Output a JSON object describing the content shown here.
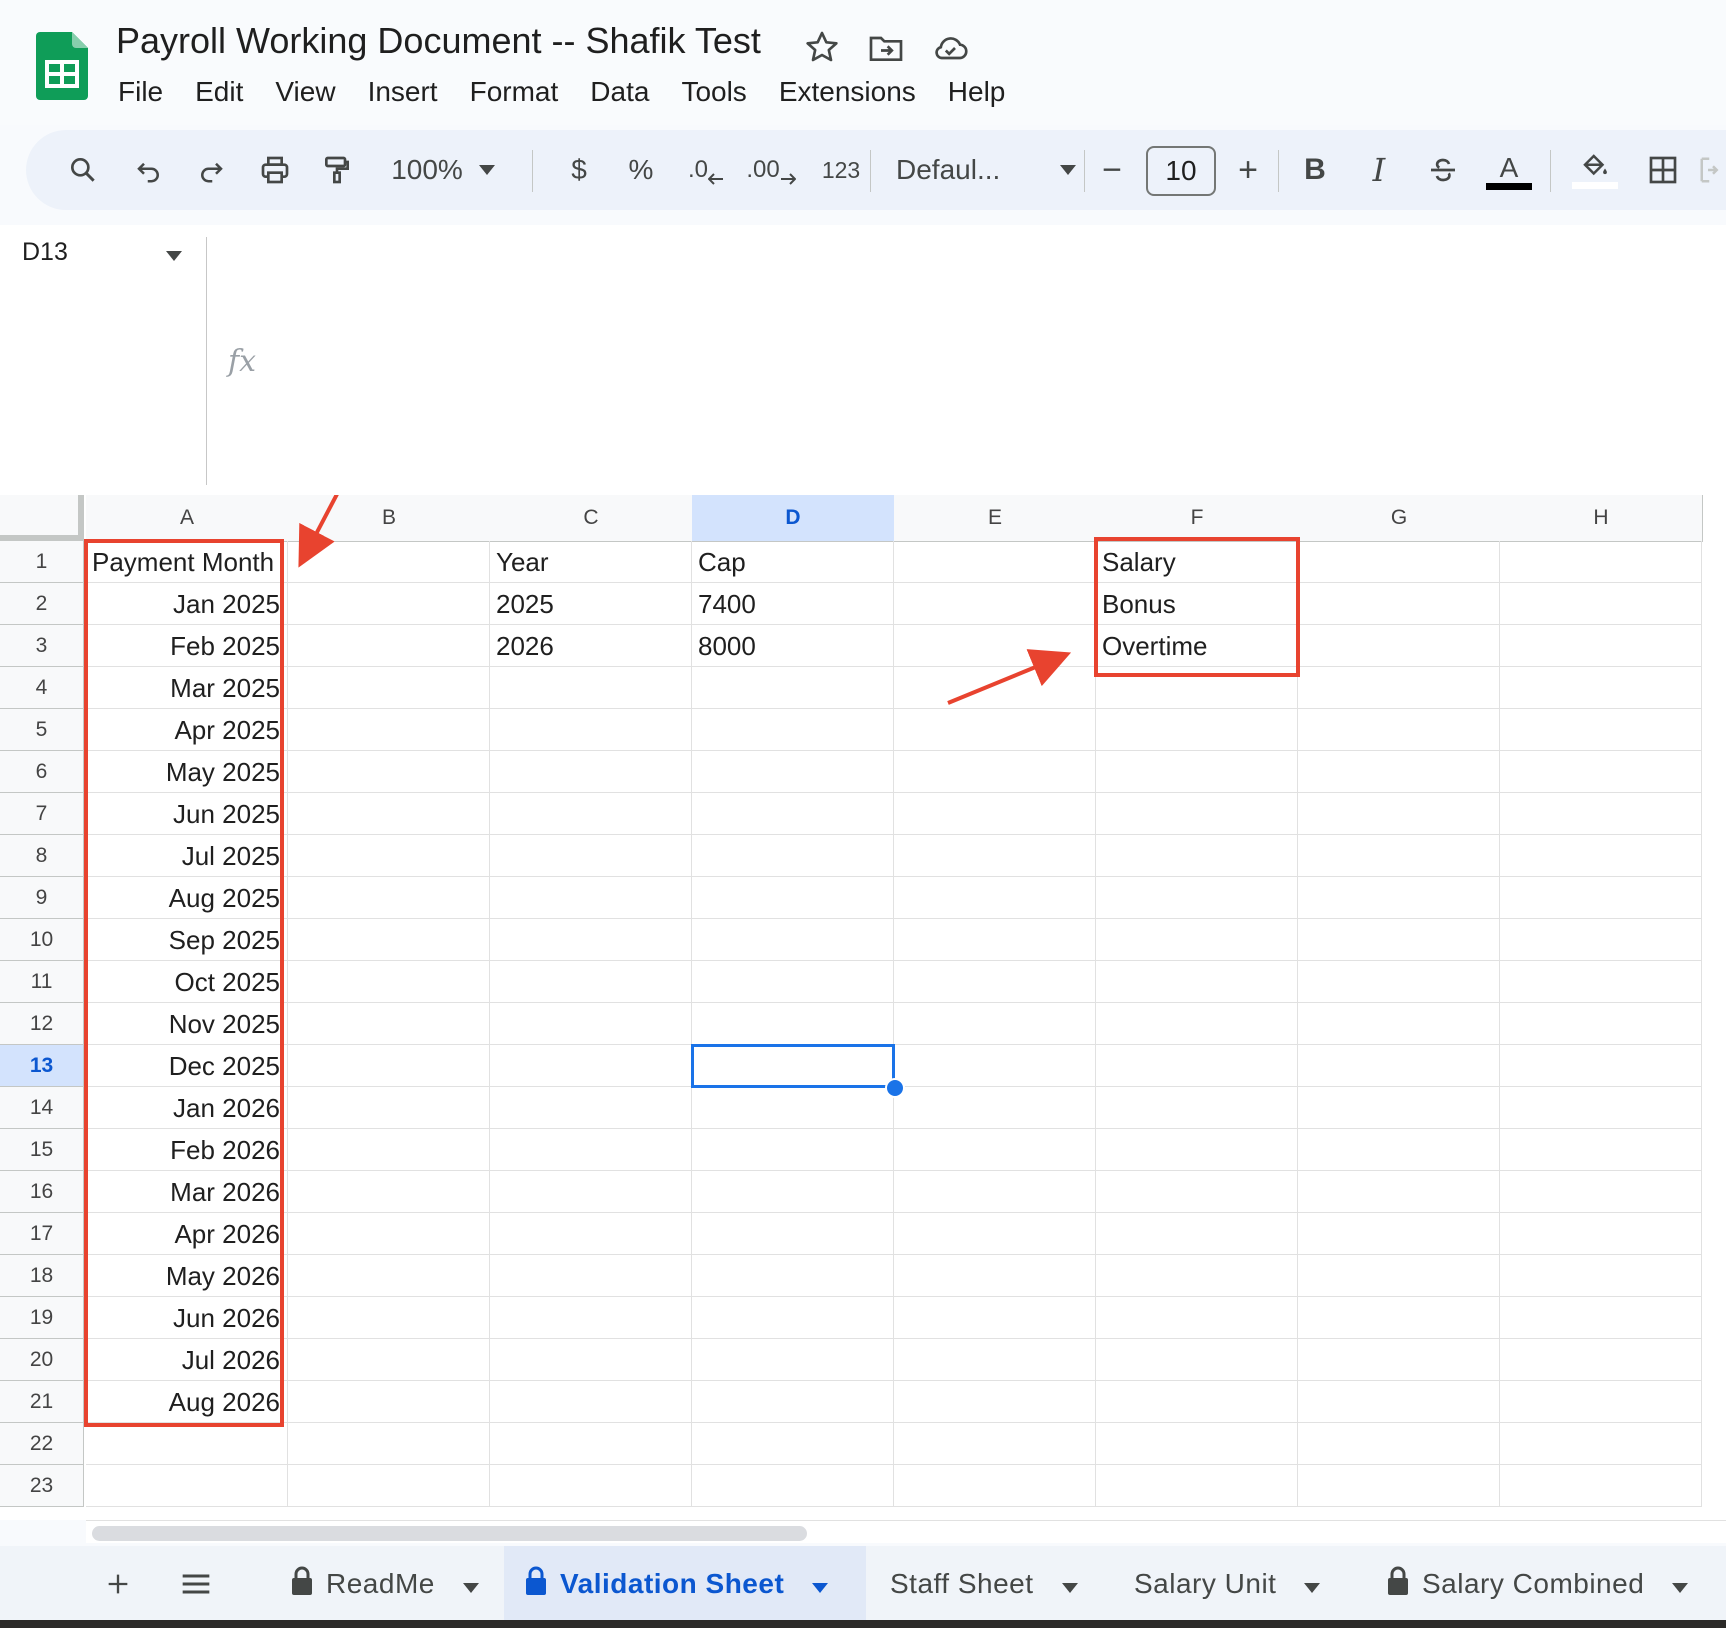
{
  "document": {
    "title": "Payroll Working Document -- Shafik Test"
  },
  "menu": [
    "File",
    "Edit",
    "View",
    "Insert",
    "Format",
    "Data",
    "Tools",
    "Extensions",
    "Help"
  ],
  "toolbar": {
    "zoom": "100%",
    "currency": "$",
    "percent": "%",
    "decrease_decimal": ".0",
    "increase_decimal": ".00",
    "number_format": "123",
    "font": "Defaul...",
    "font_size": "10",
    "minus": "−",
    "plus": "+",
    "bold": "B",
    "italic": "I",
    "text_color": "A"
  },
  "formula_bar": {
    "name_box": "D13",
    "fx": "fx",
    "value": ""
  },
  "grid": {
    "columns": [
      "A",
      "B",
      "C",
      "D",
      "E",
      "F",
      "G",
      "H"
    ],
    "selected_column": "D",
    "rows": [
      "1",
      "2",
      "3",
      "4",
      "5",
      "6",
      "7",
      "8",
      "9",
      "10",
      "11",
      "12",
      "13",
      "14",
      "15",
      "16",
      "17",
      "18",
      "19",
      "20",
      "21",
      "22",
      "23"
    ],
    "selected_row": "13",
    "selected_cell": "D13",
    "column_a": {
      "header": "Payment Month",
      "months": [
        "Jan 2025",
        "Feb 2025",
        "Mar 2025",
        "Apr 2025",
        "May 2025",
        "Jun 2025",
        "Jul 2025",
        "Aug 2025",
        "Sep 2025",
        "Oct 2025",
        "Nov 2025",
        "Dec 2025",
        "Jan 2026",
        "Feb 2026",
        "Mar 2026",
        "Apr 2026",
        "May 2026",
        "Jun 2026",
        "Jul 2026",
        "Aug 2026"
      ]
    },
    "column_c": {
      "header": "Year",
      "values": [
        "2025",
        "2026"
      ]
    },
    "column_d": {
      "header": "Cap",
      "values": [
        "7400",
        "8000"
      ]
    },
    "column_f": {
      "values": [
        "Salary",
        "Bonus",
        "Overtime"
      ]
    }
  },
  "sheet_tabs": [
    {
      "label": "ReadMe",
      "locked": true,
      "active": false
    },
    {
      "label": "Validation Sheet",
      "locked": true,
      "active": true
    },
    {
      "label": "Staff Sheet",
      "locked": false,
      "active": false
    },
    {
      "label": "Salary Unit",
      "locked": false,
      "active": false
    },
    {
      "label": "Salary Combined",
      "locked": true,
      "active": false
    }
  ],
  "colors": {
    "accent": "#0b57d0",
    "selection": "#1a73e8",
    "annotation": "#e8432f",
    "sheets_green": "#0f9d58"
  }
}
